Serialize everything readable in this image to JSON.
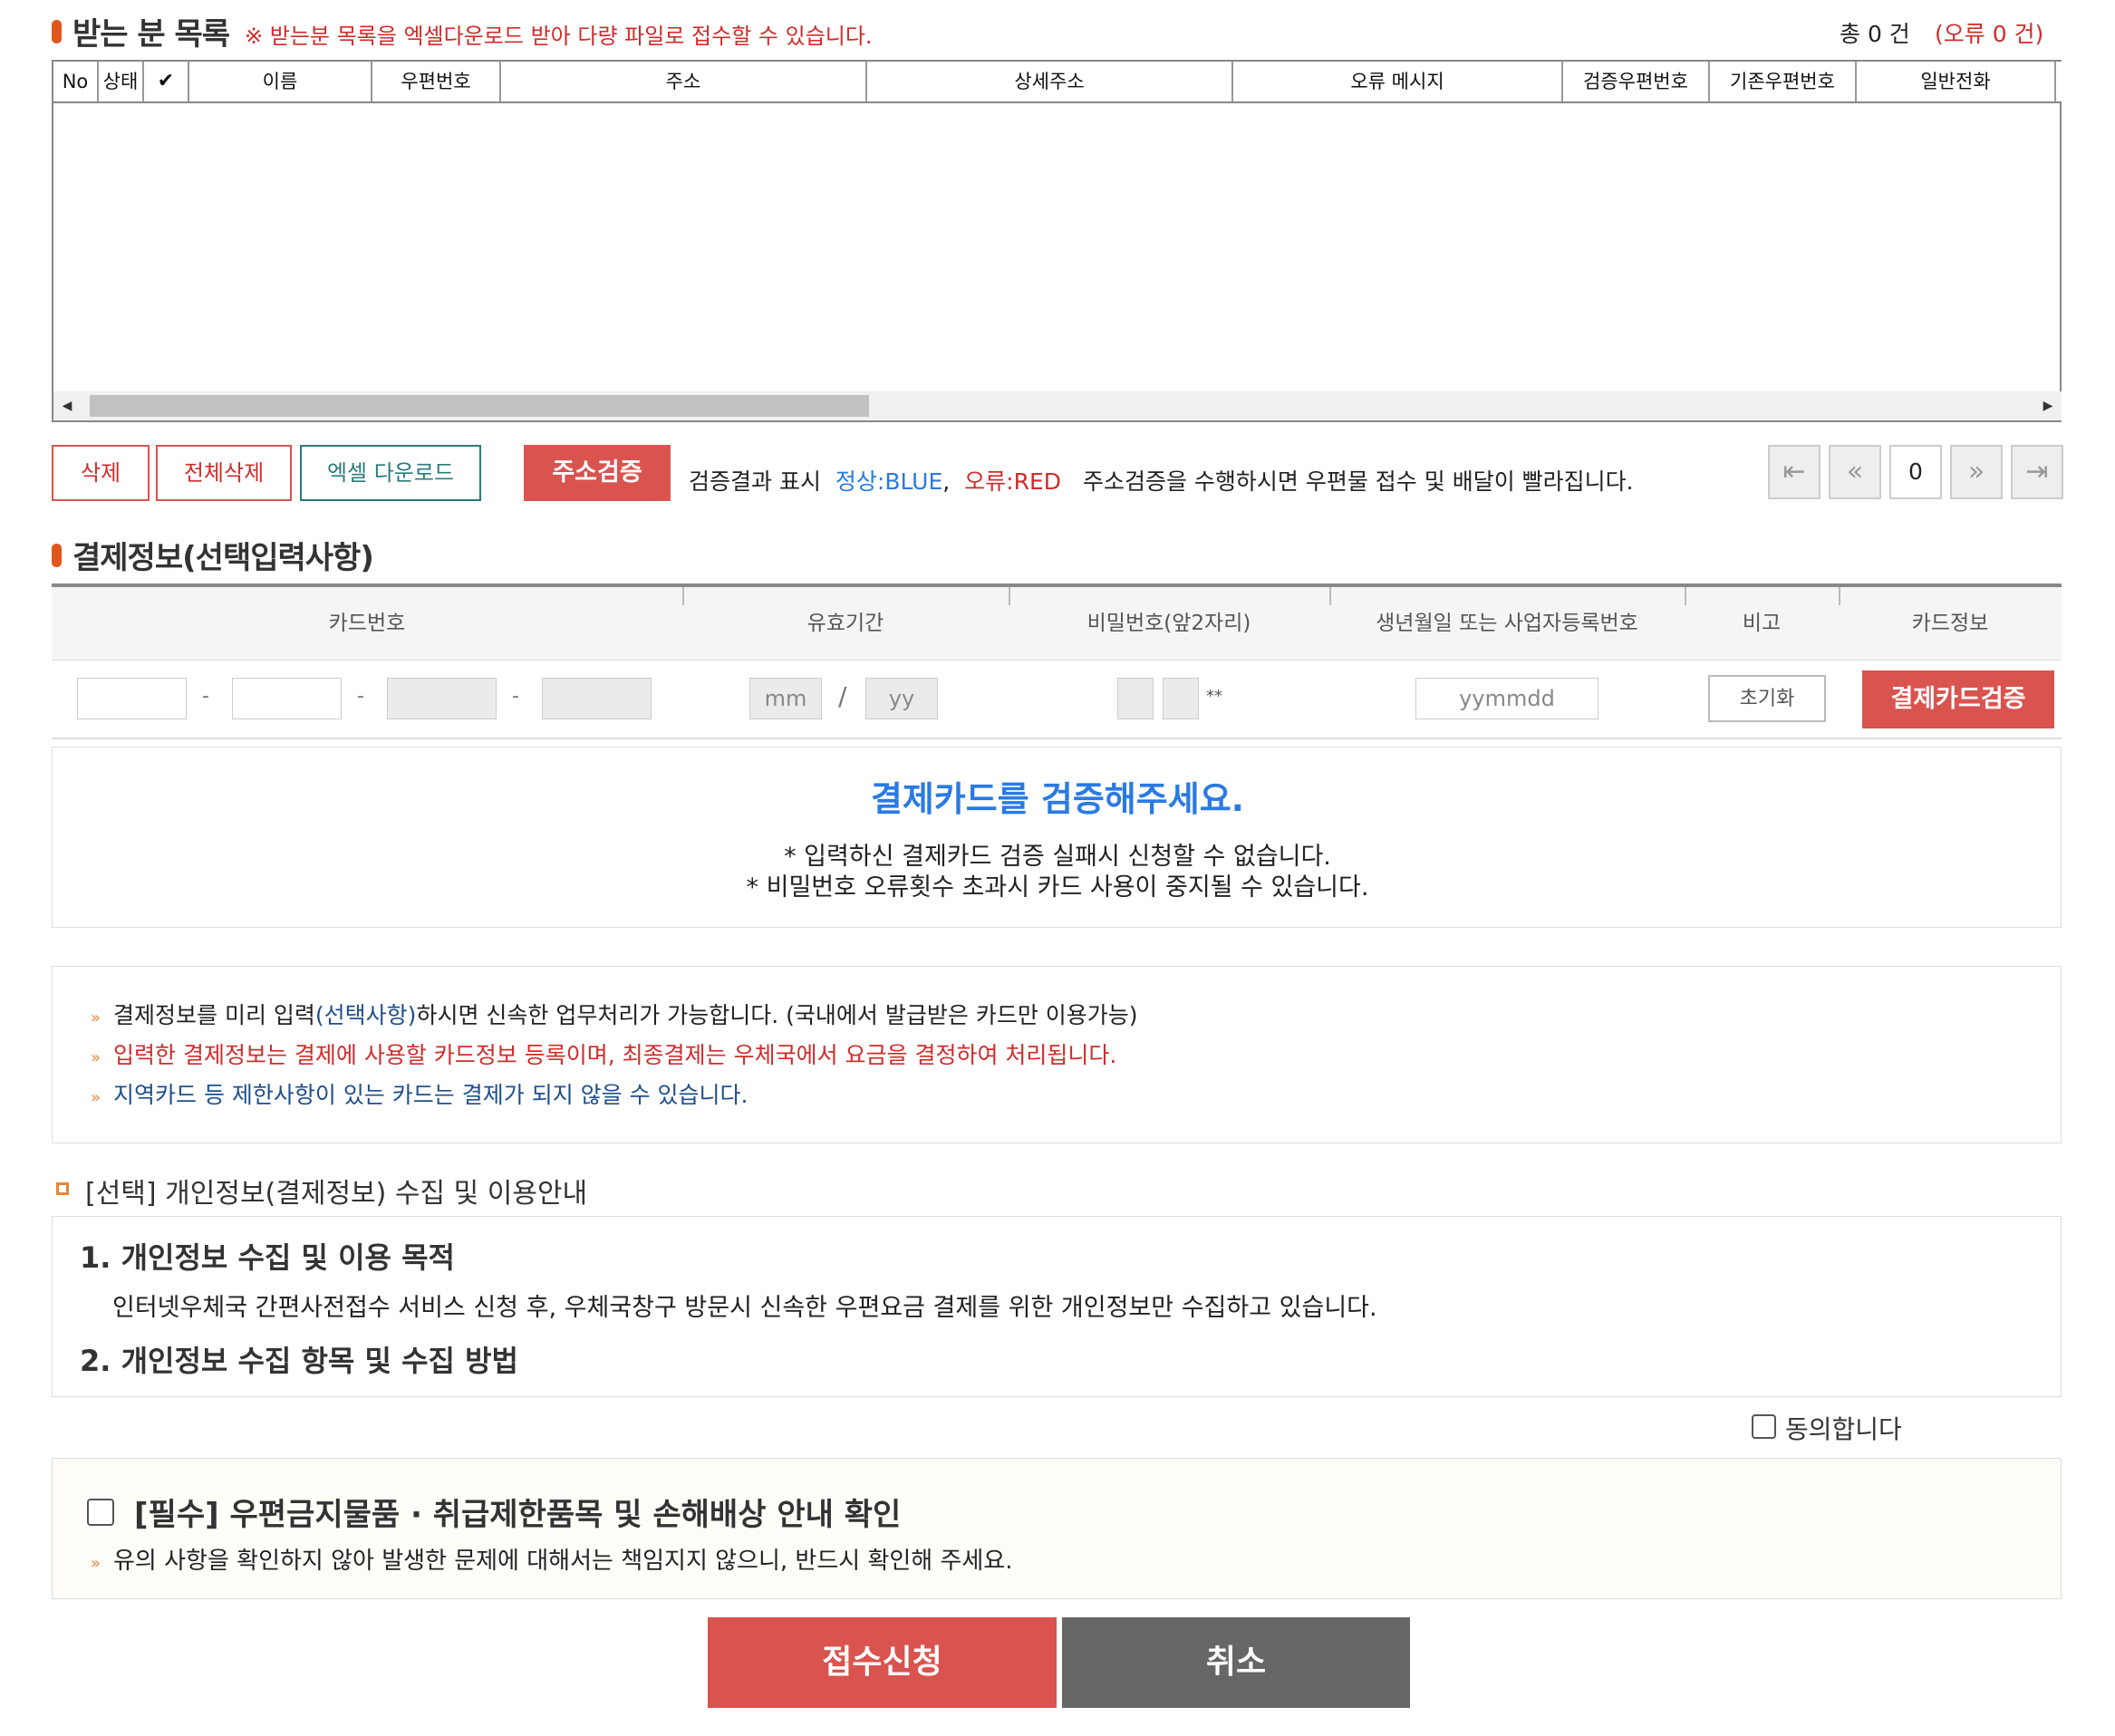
{
  "recipients": {
    "title": "받는 분 목록",
    "notice": "※ 받는분 목록을 엑셀다운로드 받아 다량 파일로 접수할 수 있습니다.",
    "total": "총 0 건",
    "errors": "(오류 0 건)",
    "columns": [
      "No",
      "상태",
      "✔",
      "이름",
      "우편번호",
      "주소",
      "상세주소",
      "오류 메시지",
      "검증우편번호",
      "기존우편번호",
      "일반전화"
    ]
  },
  "actions": {
    "delete": "삭제",
    "delete_all": "전체삭제",
    "excel_download": "엑셀 다운로드",
    "verify_address": "주소검증",
    "legend_label": "검증결과 표시",
    "legend_normal": "정상:BLUE",
    "legend_error": "오류:RED",
    "legend_hint": "주소검증을 수행하시면 우편물 접수 및 배달이 빨라집니다.",
    "page_number": "0"
  },
  "payment": {
    "title": "결제정보(선택입력사항)",
    "headers": [
      "카드번호",
      "유효기간",
      "비밀번호(앞2자리)",
      "생년월일 또는 사업자등록번호",
      "비고",
      "카드정보"
    ],
    "mm_placeholder": "mm",
    "yy_placeholder": "yy",
    "slash": "/",
    "pw_suffix": "**",
    "birth_placeholder": "yymmdd",
    "reset": "초기화",
    "verify_card": "결제카드검증",
    "verify_message": "결제카드를 검증해주세요.",
    "warn1": "* 입력하신 결제카드 검증 실패시 신청할 수 없습니다.",
    "warn2": "* 비밀번호 오류횟수 초과시 카드 사용이 중지될 수 있습니다."
  },
  "notes": {
    "n1_a": "결제정보를 미리 입력",
    "n1_b": "(선택사항)",
    "n1_c": "하시면 신속한 업무처리가 가능합니다. (국내에서 발급받은 카드만 이용가능)",
    "n2": "입력한 결제정보는 결제에 사용할 카드정보 등록이며, 최종결제는 우체국에서 요금을 결정하여 처리됩니다.",
    "n3": "지역카드 등 제한사항이 있는 카드는 결제가 되지 않을 수 있습니다."
  },
  "privacy": {
    "title": "[선택] 개인정보(결제정보) 수집 및 이용안내",
    "h1": "1. 개인정보 수집 및 이용 목적",
    "p1": "인터넷우체국 간편사전접수 서비스 신청 후, 우체국창구 방문시 신속한 우편요금 결제를 위한 개인정보만 수집하고 있습니다.",
    "h2": "2. 개인정보 수집 항목 및 수집 방법",
    "agree": "동의합니다"
  },
  "required": {
    "title": "[필수] 우편금지물품 · 취급제한품목 및 손해배상 안내 확인",
    "desc": "유의 사항을 확인하지 않아 발생한 문제에 대해서는 책임지지 않으니, 반드시 확인해 주세요."
  },
  "footer": {
    "submit": "접수신청",
    "cancel": "취소"
  }
}
